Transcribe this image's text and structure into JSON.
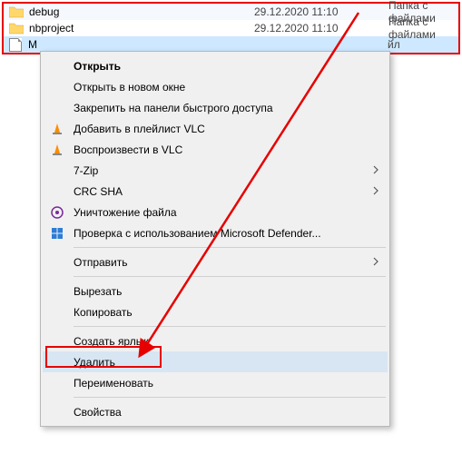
{
  "files": [
    {
      "icon": "folder",
      "name": "debug",
      "date": "29.12.2020 11:10",
      "type": "Папка с файлами"
    },
    {
      "icon": "folder",
      "name": "nbproject",
      "date": "29.12.2020 11:10",
      "type": "Папка с файлами"
    },
    {
      "icon": "file",
      "name": "M",
      "date": "",
      "type": "йл"
    }
  ],
  "menu": {
    "open": "Открыть",
    "open_new": "Открыть в новом окне",
    "pin_quick": "Закрепить на панели быстрого доступа",
    "vlc_add": "Добавить в плейлист VLC",
    "vlc_play": "Воспроизвести в VLC",
    "sevenzip": "7-Zip",
    "crcsha": "CRC SHA",
    "shred": "Уничтожение файла",
    "defender": "Проверка с использованием Microsoft Defender...",
    "send_to": "Отправить",
    "cut": "Вырезать",
    "copy": "Копировать",
    "shortcut": "Создать ярлык",
    "delete": "Удалить",
    "rename": "Переименовать",
    "properties": "Свойства"
  },
  "colors": {
    "highlight": "#e60000",
    "vlc": "#ff8c00"
  }
}
